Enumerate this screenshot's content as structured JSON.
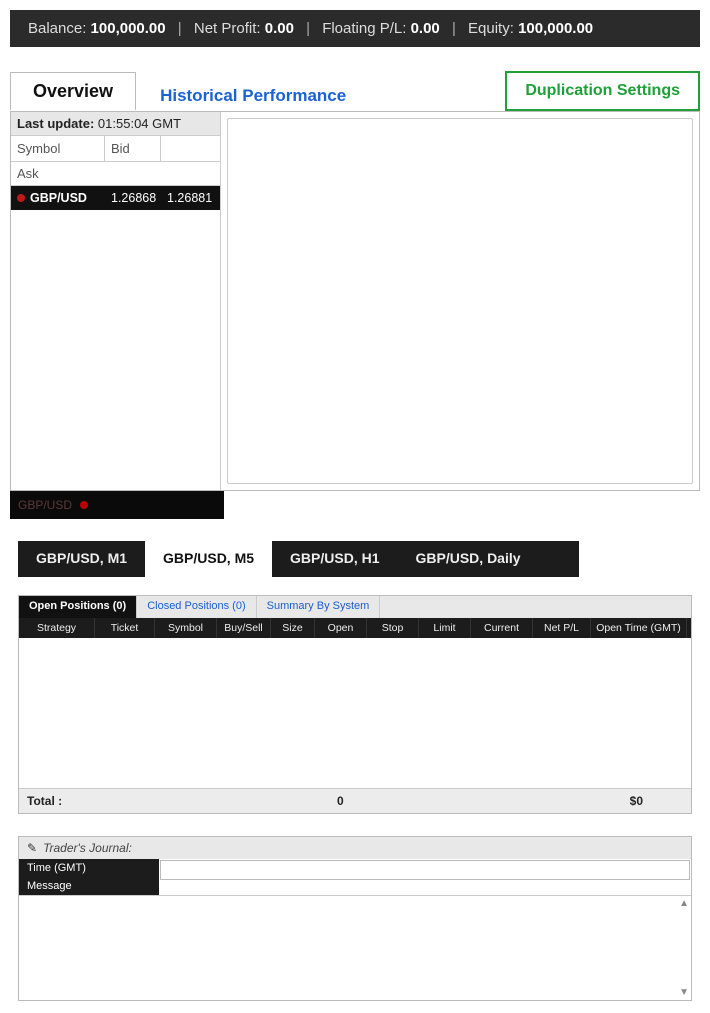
{
  "status": {
    "balance_label": "Balance:",
    "balance_value": "100,000.00",
    "netprofit_label": "Net Profit:",
    "netprofit_value": "0.00",
    "floating_label": "Floating P/L:",
    "floating_value": "0.00",
    "equity_label": "Equity:",
    "equity_value": "100,000.00"
  },
  "nav": {
    "overview": "Overview",
    "historical": "Historical Performance",
    "duplication": "Duplication Settings"
  },
  "quotes": {
    "last_update_label": "Last update:",
    "last_update_time": "01:55:04 GMT",
    "col_symbol": "Symbol",
    "col_bid": "Bid",
    "col_ask": "Ask",
    "row": {
      "symbol": "GBP/USD",
      "bid": "1.26868",
      "ask": "1.26881"
    }
  },
  "subbar_symbol": "GBP/USD",
  "tf_tabs": [
    "GBP/USD, M1",
    "GBP/USD, M5",
    "GBP/USD, H1",
    "GBP/USD, Daily"
  ],
  "positions": {
    "tabs": {
      "open": "Open Positions (0)",
      "closed": "Closed Positions (0)",
      "summary": "Summary By System"
    },
    "cols": [
      "Strategy",
      "Ticket",
      "Symbol",
      "Buy/Sell",
      "Size",
      "Open",
      "Stop",
      "Limit",
      "Current",
      "Net P/L",
      "Open Time (GMT)"
    ],
    "total_label": "Total :",
    "total_size": "0",
    "total_pl": "$0"
  },
  "journal": {
    "title": "Trader's Journal:",
    "time_label": "Time (GMT)",
    "message_label": "Message"
  }
}
